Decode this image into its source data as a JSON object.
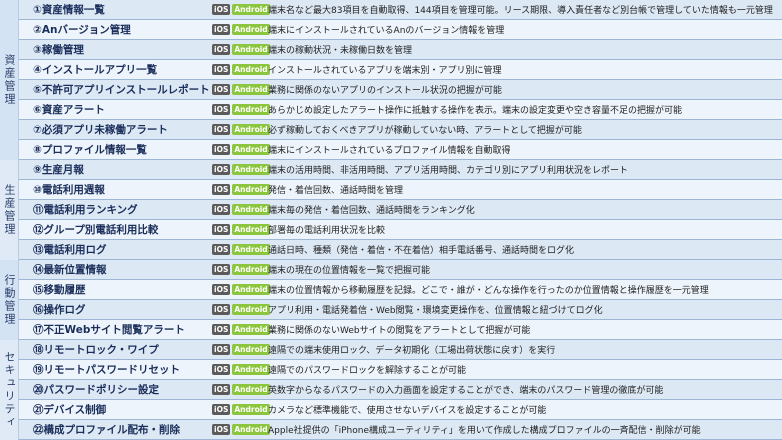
{
  "colors": {
    "group_bg": [
      "#d4e3f3",
      "#dfeaf6",
      "#d4e3f3",
      "#dfeaf6"
    ],
    "row_light": "#eef4fb",
    "row_dark": "#dde8f5",
    "ios_badge": "#5b5b5b",
    "android_badge": "#8cc63f"
  },
  "badges": {
    "ios": "iOS",
    "android": "Android"
  },
  "groups": [
    {
      "label": "資産管理",
      "rows": [
        {
          "name": "①資産情報一覧",
          "desc": "端末名など最大83項目を自動取得、144項目を管理可能。リース期限、導入責任者など別台帳で管理していた情報も一元管理"
        },
        {
          "name": "②Anバージョン管理",
          "desc": "端末にインストールされているAnのバージョン情報を管理"
        },
        {
          "name": "③稼働管理",
          "desc": "端末の稼動状況・未稼働日数を管理"
        },
        {
          "name": "④インストールアプリ一覧",
          "desc": "インストールされているアプリを端末別・アプリ別に管理"
        },
        {
          "name": "⑤不許可アプリインストールレポート",
          "desc": "業務に関係のないアプリのインストール状況の把握が可能"
        },
        {
          "name": "⑥資産アラート",
          "desc": "あらかじめ設定したアラート操作に抵触する操作を表示。端末の設定変更や空き容量不足の把握が可能"
        },
        {
          "name": "⑦必須アプリ未稼働アラート",
          "desc": "必ず稼動しておくべきアプリが稼動していない時、アラートとして把握が可能"
        },
        {
          "name": "⑧プロファイル情報一覧",
          "desc": "端末にインストールされているプロファイル情報を自動取得"
        }
      ]
    },
    {
      "label": "生産管理",
      "rows": [
        {
          "name": "⑨生産月報",
          "desc": "端末の活用時間、非活用時間、アプリ活用時間、カテゴリ別にアプリ利用状況をレポート"
        },
        {
          "name": "⑩電話利用週報",
          "desc": "発信・着信回数、通話時間を管理"
        },
        {
          "name": "⑪電話利用ランキング",
          "desc": "端末毎の発信・着信回数、通話時間をランキング化"
        },
        {
          "name": "⑫グループ別電話利用比較",
          "desc": "部署毎の電話利用状況を比較"
        },
        {
          "name": "⑬電話利用ログ",
          "desc": "通話日時、種類（発信・着信・不在着信）相手電話番号、通話時間をログ化"
        }
      ]
    },
    {
      "label": "行動管理",
      "rows": [
        {
          "name": "⑭最新位置情報",
          "desc": "端末の現在の位置情報を一覧で把握可能"
        },
        {
          "name": "⑮移動履歴",
          "desc": "端末の位置情報から移動履歴を記録。どこで・誰が・どんな操作を行ったのか位置情報と操作履歴を一元管理"
        },
        {
          "name": "⑯操作ログ",
          "desc": "アプリ利用・電話発着信・Web閲覧・環境変更操作を、位置情報と紐づけてログ化"
        },
        {
          "name": "⑰不正Webサイト閲覧アラート",
          "desc": "業務に関係のないWebサイトの閲覧をアラートとして把握が可能"
        }
      ]
    },
    {
      "label": "セキュリティ",
      "rows": [
        {
          "name": "⑱リモートロック・ワイプ",
          "desc": "遠隔での端末使用ロック、データ初期化（工場出荷状態に戻す）を実行"
        },
        {
          "name": "⑲リモートパスワードリセット",
          "desc": "遠隔でのパスワードロックを解除することが可能"
        },
        {
          "name": "⑳パスワードポリシー設定",
          "desc": "英数字からなるパスワードの入力画面を設定することができ、端末のパスワード管理の徹底が可能"
        },
        {
          "name": "㉑デバイス制御",
          "desc": "カメラなど標準機能で、使用させないデバイスを設定することが可能"
        },
        {
          "name": "㉒構成プロファイル配布・削除",
          "desc": "Apple社提供の「iPhone構成ユーティリティ」を用いて作成した構成プロファイルの一斉配信・削除が可能"
        }
      ]
    }
  ]
}
